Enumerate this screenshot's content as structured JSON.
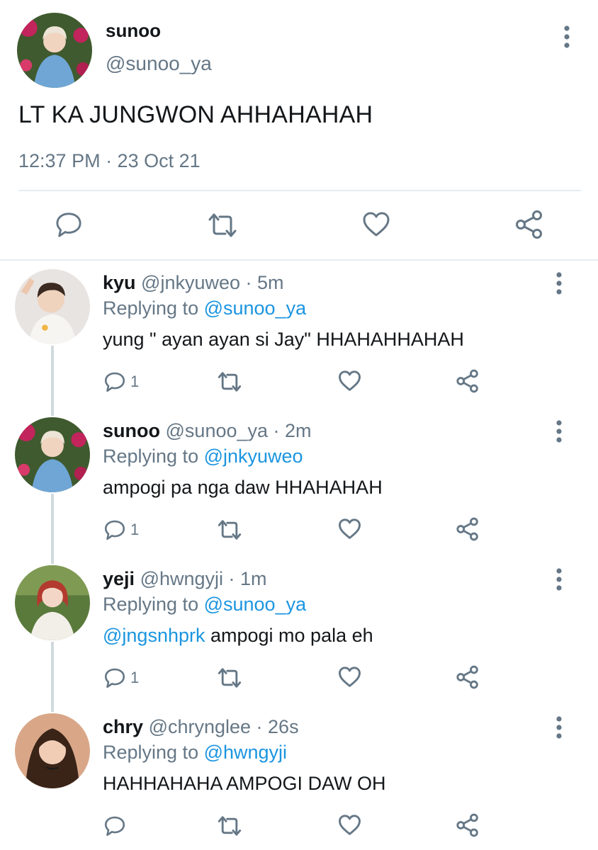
{
  "main_tweet": {
    "name": "sunoo",
    "handle": "@sunoo_ya",
    "text": "LT KA JUNGWON AHHAHAHAH",
    "timestamp": "12:37 PM · 23 Oct 21",
    "actions": [
      "reply-icon",
      "retweet-icon",
      "like-icon",
      "share-icon"
    ]
  },
  "replies": [
    {
      "name": "kyu",
      "meta": "@jnkyuweo · 5m",
      "replying_prefix": "Replying to ",
      "replying_to": "@sunoo_ya",
      "mention": "",
      "text": "yung \" ayan ayan si Jay\" HHAHAHHAHAH",
      "reply_count": "1"
    },
    {
      "name": "sunoo",
      "meta": "@sunoo_ya · 2m",
      "replying_prefix": "Replying to ",
      "replying_to": "@jnkyuweo",
      "mention": "",
      "text": "ampogi pa nga daw HHAHAHAH",
      "reply_count": "1"
    },
    {
      "name": "yeji",
      "meta": "@hwngyji · 1m",
      "replying_prefix": "Replying to ",
      "replying_to": "@sunoo_ya",
      "mention": "@jngsnhprk",
      "text": " ampogi mo pala eh",
      "reply_count": "1"
    },
    {
      "name": "chry",
      "meta": "@chrynglee · 26s",
      "replying_prefix": "Replying to ",
      "replying_to": "@hwngyji",
      "mention": "",
      "text": "HAHHAHAHA AMPOGI DAW OH",
      "reply_count": ""
    }
  ],
  "colors": {
    "text": "#14171a",
    "secondary": "#657786",
    "link": "#1b95e0",
    "divider": "#e6ecf0",
    "thread_line": "#cfd9de"
  }
}
